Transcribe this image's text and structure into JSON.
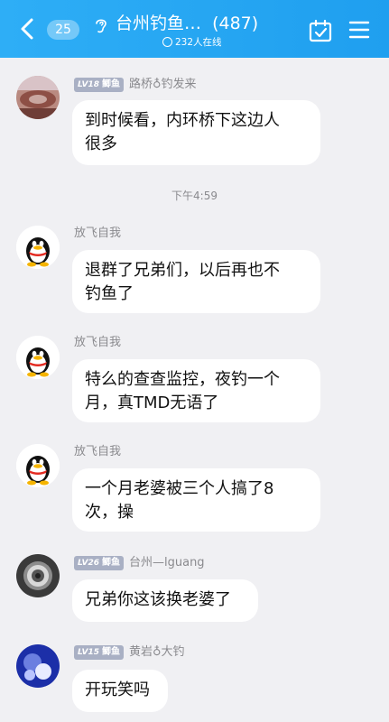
{
  "header": {
    "unread_count": "25",
    "group_title": "台州钓鱼…",
    "member_count": "(487)",
    "online_text": "232人在线"
  },
  "timestamp": "下午4:59",
  "messages": [
    {
      "level": "LV18",
      "badge": "鲫鱼",
      "sender": "路桥♁钓发来",
      "text1": "到时候看，内环桥下这边人",
      "text2": "很多"
    },
    {
      "sender": "放飞自我",
      "text1": "退群了兄弟们，以后再也不",
      "text2": "钓鱼了"
    },
    {
      "sender": "放飞自我",
      "text1": "特么的查查监控，夜钓一个",
      "text2": "月，真TMD无语了"
    },
    {
      "sender": "放飞自我",
      "text1": "一个月老婆被三个人搞了8",
      "text2": "次，操"
    },
    {
      "level": "LV26",
      "badge": "鲫鱼",
      "sender": "台州—lguang",
      "text1": "兄弟你这该换老婆了"
    },
    {
      "level": "LV15",
      "badge": "鲫鱼",
      "sender": "黄岩♁大钓",
      "text1": "开玩笑吗"
    }
  ],
  "icons": {
    "back": "chevron-left-icon",
    "ear": "ear-icon",
    "calendar": "calendar-check-icon",
    "menu": "menu-icon"
  },
  "colors": {
    "header_bg": "#2eaef6",
    "background": "#f0f0f3",
    "bubble": "#ffffff",
    "level_badge": "#a9b0c4"
  }
}
